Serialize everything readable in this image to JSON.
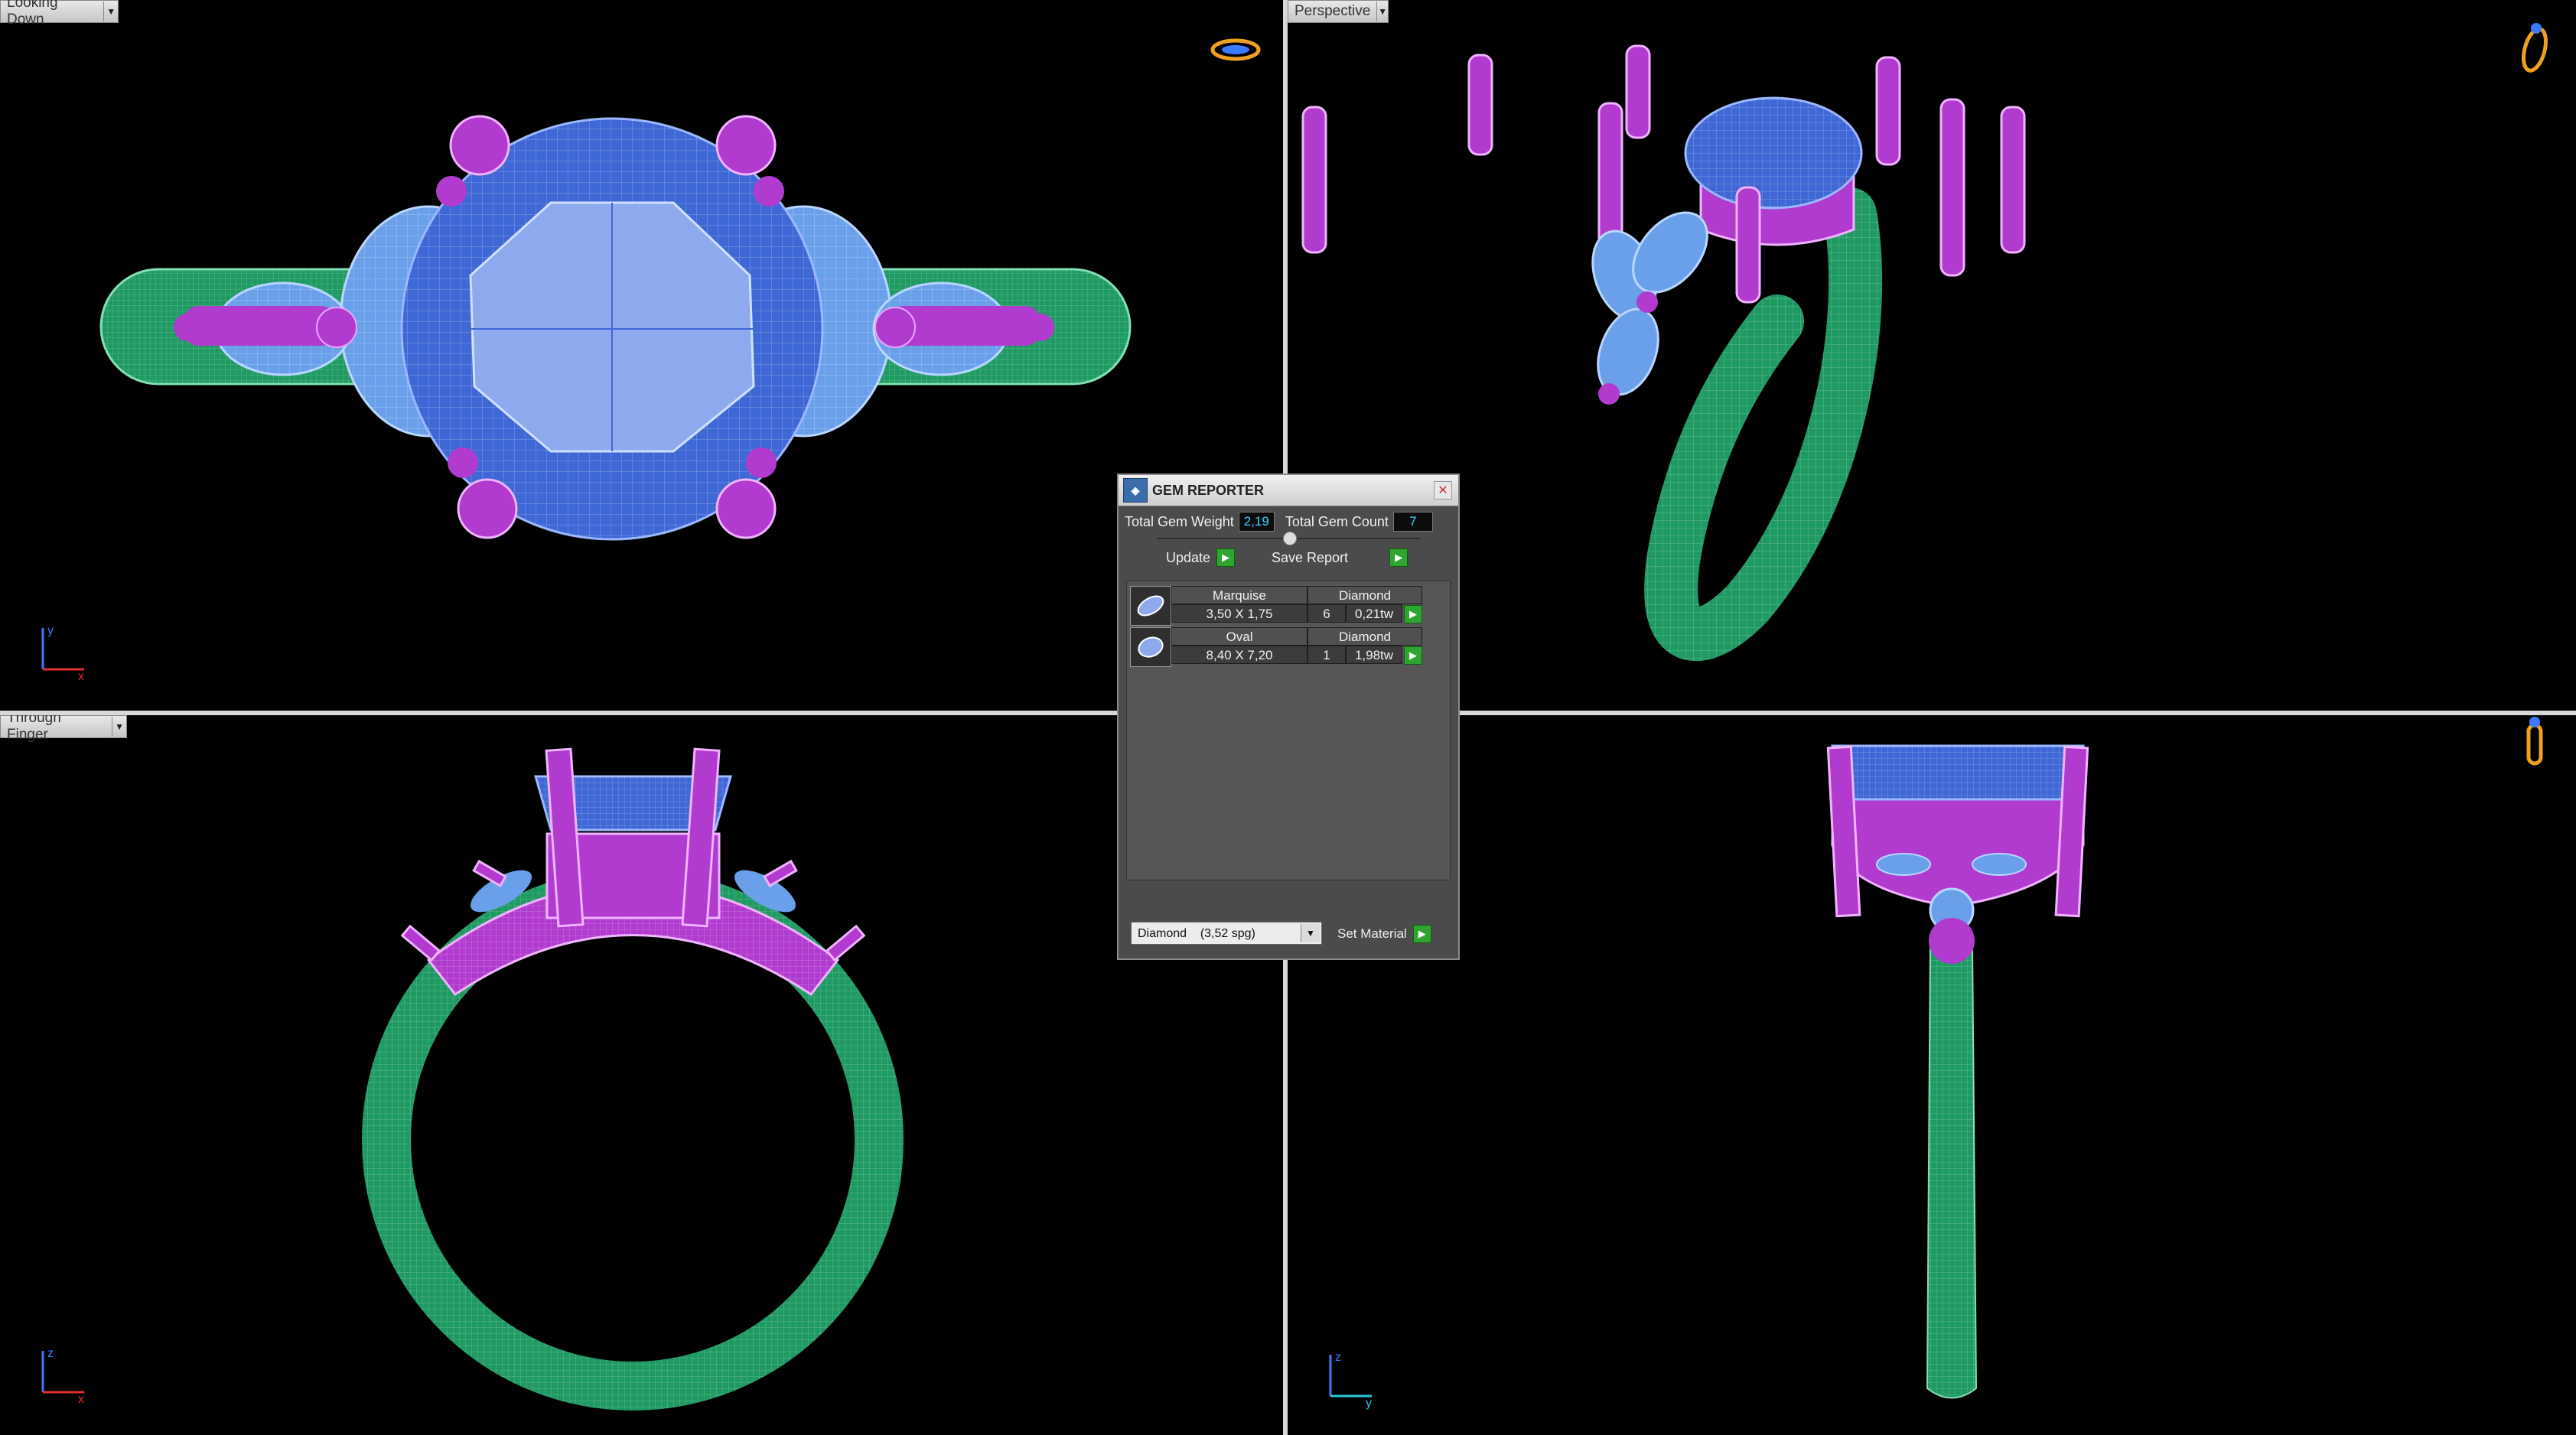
{
  "viewports": {
    "top_left": {
      "label": "Looking Down",
      "axis_v": "y",
      "axis_h": "x"
    },
    "top_right": {
      "label": "Perspective"
    },
    "bottom_left": {
      "label": "Through Finger",
      "axis_v": "z",
      "axis_h": "x"
    },
    "bottom_right": {
      "axis_v": "z",
      "axis_h": "y"
    }
  },
  "gem_reporter": {
    "title": "GEM REPORTER",
    "total_weight_label": "Total Gem Weight",
    "total_weight_value": "2,19",
    "total_count_label": "Total Gem Count",
    "total_count_value": "7",
    "update_label": "Update",
    "save_report_label": "Save Report",
    "gems": [
      {
        "cut": "Marquise",
        "material": "Diamond",
        "size": "3,50 X 1,75",
        "qty": "6",
        "weight": "0,21tw"
      },
      {
        "cut": "Oval",
        "material": "Diamond",
        "size": "8,40 X 7,20",
        "qty": "1",
        "weight": "1,98tw"
      }
    ],
    "material_select": "Diamond    (3,52 spg)",
    "set_material_label": "Set Material"
  },
  "colors": {
    "band": "#1f9a63",
    "metal": "#b13bcf",
    "gem": "#3f68d6",
    "side_gem": "#6aa0ea",
    "panel_bg": "#4b4b4b",
    "value_text": "#3bd1ff"
  },
  "icons": {
    "close": "close-icon",
    "go": "green-arrow-icon",
    "dropdown": "chevron-down-icon"
  }
}
